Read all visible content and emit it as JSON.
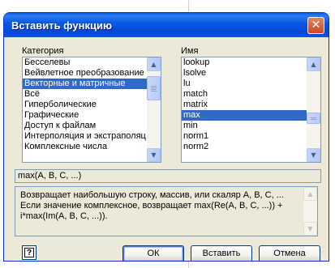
{
  "dialog": {
    "title": "Вставить функцию",
    "close_glyph": "✕"
  },
  "category": {
    "label": "Категория",
    "items": [
      "Бесселевы",
      "Вейвлетное преобразование",
      "Векторные и матричные",
      "Всё",
      "Гиперболические",
      "Графические",
      "Доступ к файлам",
      "Интерполяция и экстраполяц",
      "Комплексные числа"
    ],
    "selected_index": 2
  },
  "name": {
    "label": "Имя",
    "items": [
      "lookup",
      "lsolve",
      "lu",
      "match",
      "matrix",
      "max",
      "min",
      "norm1",
      "norm2"
    ],
    "selected_index": 5
  },
  "syntax": "max(A, B, C, ...)",
  "description": "Возвращает наибольшую строку, массив, или скаляр A, B, C, ...\nЕсли значение комплексное, возвращает max(Re(A, B, C, ...)) +\ni*max(Im(A, B, C, ...)).",
  "buttons": {
    "help": "?",
    "ok": "ОК",
    "insert": "Вставить",
    "cancel": "Отмена"
  },
  "icons": {
    "scroll_up": "scroll-up-arrow-icon",
    "scroll_down": "scroll-down-arrow-icon",
    "help": "help-icon",
    "close": "close-icon"
  },
  "colors": {
    "titlebar": "#0a59e0",
    "selection": "#316ac5",
    "close_button": "#d9622f",
    "dialog_face": "#ece9d8"
  }
}
